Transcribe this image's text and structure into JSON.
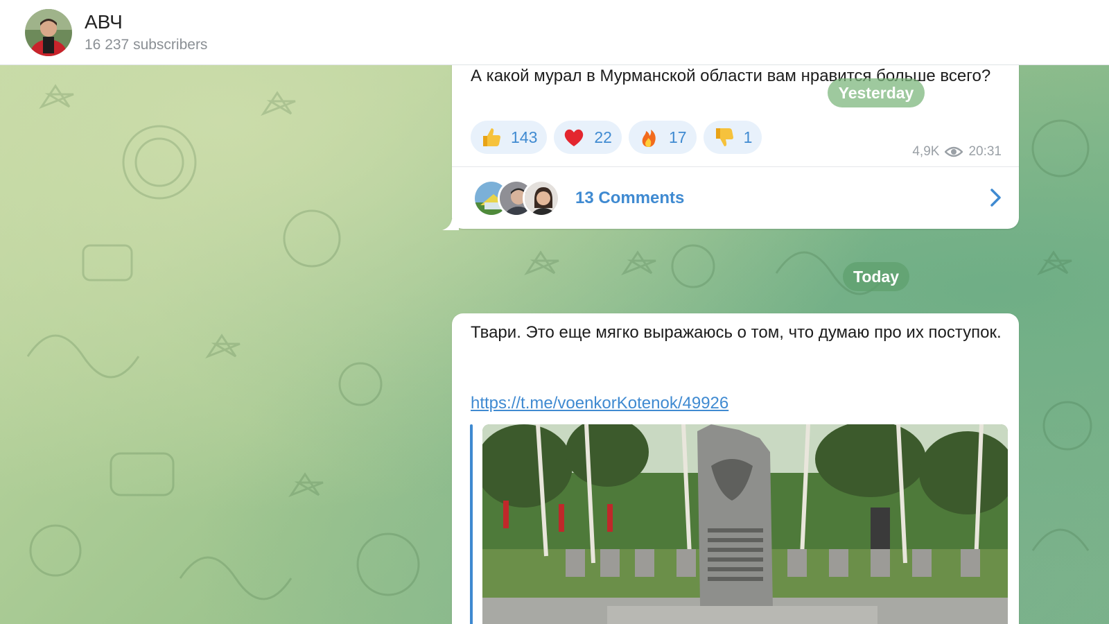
{
  "header": {
    "channel_name": "АВЧ",
    "subscribers": "16 237 subscribers"
  },
  "messages": [
    {
      "text": "А какой мурал в Мурманской области вам нравится больше всего?",
      "reactions": [
        {
          "emoji": "thumbs-up",
          "count": "143"
        },
        {
          "emoji": "heart",
          "count": "22"
        },
        {
          "emoji": "fire",
          "count": "17"
        },
        {
          "emoji": "thumbs-down",
          "count": "1"
        }
      ],
      "views": "4,9K",
      "time": "20:31",
      "comments_label": "13 Comments"
    },
    {
      "text": "Твари. Это еще мягко выражаюсь о том, что думаю про их поступок.",
      "link": "https://t.me/voenkorKotenok/49926"
    }
  ],
  "date_separators": {
    "yesterday": "Yesterday",
    "today": "Today"
  },
  "icons": {
    "views": "eye-icon",
    "comments_arrow": "chevron-right-icon"
  },
  "colors": {
    "accent": "#3f8ad1",
    "reaction_bg": "#e8f1fb"
  }
}
